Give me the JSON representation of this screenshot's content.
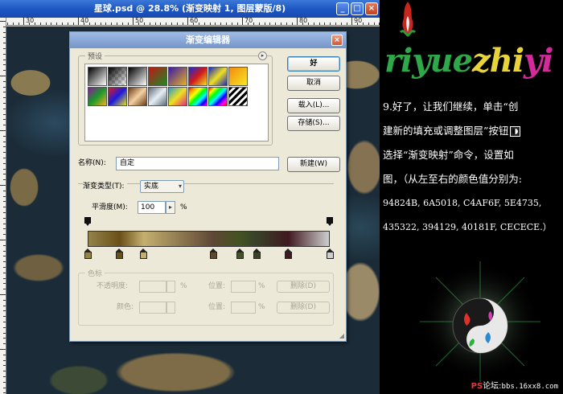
{
  "document": {
    "title": "星球.psd @ 28.8% (渐变映射 1, 图层蒙版/8)",
    "ruler_labels": [
      "30",
      "40",
      "50",
      "60",
      "70",
      "80",
      "90"
    ]
  },
  "dialog": {
    "title": "渐变编辑器",
    "presets_label": "预设",
    "name_label": "名称(N):",
    "name_value": "自定",
    "new_button": "新建(W)",
    "ok_button": "好",
    "cancel_button": "取消",
    "load_button": "载入(L)...",
    "save_button": "存储(S)...",
    "gradient_type_label": "渐变类型(T):",
    "gradient_type_value": "实底",
    "smoothness_label": "平滑度(M):",
    "smoothness_value": "100",
    "smoothness_unit": "%",
    "stops_label": "色标",
    "opacity_label": "不透明度:",
    "opacity_unit": "%",
    "location_label": "位置:",
    "location_unit": "%",
    "delete_label": "删除(D)",
    "color_label": "颜色:",
    "gradient_stops": [
      {
        "color": "#94824B",
        "location": 0
      },
      {
        "color": "#6A5018",
        "location": 13
      },
      {
        "color": "#C4AF6F",
        "location": 23
      },
      {
        "color": "#5E4735",
        "location": 52
      },
      {
        "color": "#435322",
        "location": 63
      },
      {
        "color": "#394129",
        "location": 70
      },
      {
        "color": "#40181F",
        "location": 83
      },
      {
        "color": "#CECECE",
        "location": 100
      }
    ],
    "opacity_stops": [
      0,
      100
    ]
  },
  "tutorial": {
    "logo": [
      "riyue",
      "zhi",
      "yi"
    ],
    "lines": [
      "9.好了，让我们继续，单击“创",
      "建新的填充或调整图层”按钮",
      "选择“渐变映射”命令，设置如",
      "图，（从左至右的颜色值分别为:",
      "94824B, 6A5018, C4AF6F, 5E4735,",
      "435322, 394129, 40181F, CECECE.）"
    ],
    "footer_ps": "PS",
    "footer_text": "论坛:",
    "footer_url": "bbs.16xx8.com"
  }
}
